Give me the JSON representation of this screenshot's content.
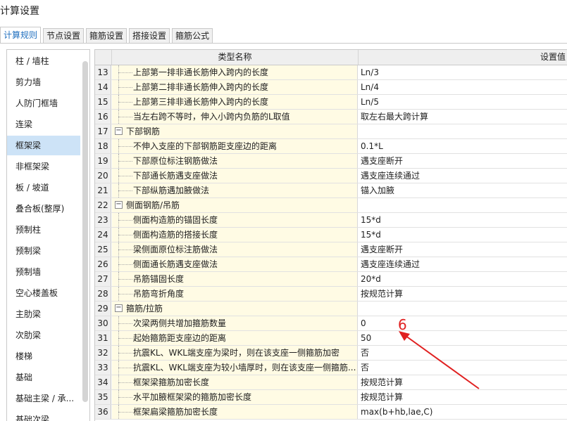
{
  "window_title": "计算设置",
  "tabs": [
    "计算规则",
    "节点设置",
    "箍筋设置",
    "搭接设置",
    "箍筋公式"
  ],
  "sidebar": {
    "items": [
      "柱 / 墙柱",
      "剪力墙",
      "人防门框墙",
      "连梁",
      "框架梁",
      "非框架梁",
      "板 / 坡道",
      "叠合板(整厚)",
      "预制柱",
      "预制梁",
      "预制墙",
      "空心楼盖板",
      "主肋梁",
      "次肋梁",
      "楼梯",
      "基础",
      "基础主梁 / 承...",
      "基础次梁"
    ],
    "active_index": 4
  },
  "grid": {
    "headers": {
      "name": "类型名称",
      "value": "设置值"
    },
    "rows": [
      {
        "num": "13",
        "name": "上部第一排非通长筋伸入跨内的长度",
        "value": "Ln/3",
        "type": "item"
      },
      {
        "num": "14",
        "name": "上部第二排非通长筋伸入跨内的长度",
        "value": "Ln/4",
        "type": "item"
      },
      {
        "num": "15",
        "name": "上部第三排非通长筋伸入跨内的长度",
        "value": "Ln/5",
        "type": "item"
      },
      {
        "num": "16",
        "name": "当左右跨不等时，伸入小跨内负筋的L取值",
        "value": "取左右最大跨计算",
        "type": "item"
      },
      {
        "num": "17",
        "name": "下部钢筋",
        "value": "",
        "type": "group"
      },
      {
        "num": "18",
        "name": "不伸入支座的下部钢筋距支座边的距离",
        "value": "0.1*L",
        "type": "item"
      },
      {
        "num": "19",
        "name": "下部原位标注钢筋做法",
        "value": "遇支座断开",
        "type": "item"
      },
      {
        "num": "20",
        "name": "下部通长筋遇支座做法",
        "value": "遇支座连续通过",
        "type": "item"
      },
      {
        "num": "21",
        "name": "下部纵筋遇加腋做法",
        "value": "锚入加腋",
        "type": "item"
      },
      {
        "num": "22",
        "name": "侧面钢筋/吊筋",
        "value": "",
        "type": "group"
      },
      {
        "num": "23",
        "name": "侧面构造筋的锚固长度",
        "value": "15*d",
        "type": "item"
      },
      {
        "num": "24",
        "name": "侧面构造筋的搭接长度",
        "value": "15*d",
        "type": "item"
      },
      {
        "num": "25",
        "name": "梁侧面原位标注筋做法",
        "value": "遇支座断开",
        "type": "item"
      },
      {
        "num": "26",
        "name": "侧面通长筋遇支座做法",
        "value": "遇支座连续通过",
        "type": "item"
      },
      {
        "num": "27",
        "name": "吊筋锚固长度",
        "value": "20*d",
        "type": "item"
      },
      {
        "num": "28",
        "name": "吊筋弯折角度",
        "value": "按规范计算",
        "type": "item"
      },
      {
        "num": "29",
        "name": "箍筋/拉筋",
        "value": "",
        "type": "group"
      },
      {
        "num": "30",
        "name": "次梁两侧共增加箍筋数量",
        "value": "0",
        "type": "item"
      },
      {
        "num": "31",
        "name": "起始箍筋距支座边的距离",
        "value": "50",
        "type": "item"
      },
      {
        "num": "32",
        "name": "抗震KL、WKL端支座为梁时，则在该支座一侧箍筋加密",
        "value": "否",
        "type": "item"
      },
      {
        "num": "33",
        "name": "抗震KL、WKL端支座为较小墙厚时，则在该支座一侧箍筋...",
        "value": "否",
        "type": "item"
      },
      {
        "num": "34",
        "name": "框架梁箍筋加密长度",
        "value": "按规范计算",
        "type": "item"
      },
      {
        "num": "35",
        "name": "水平加腋框架梁的箍筋加密长度",
        "value": "按规范计算",
        "type": "item"
      },
      {
        "num": "36",
        "name": "框架扁梁箍筋加密长度",
        "value": "max(b+hb,lae,C)",
        "type": "item"
      }
    ]
  },
  "annotation": {
    "label": "6",
    "color": "#e02020"
  },
  "colors": {
    "active_tab_text": "#1f6fbf",
    "selected_sidebar": "#cde3f7",
    "name_cell_bg": "#fffbe4"
  }
}
